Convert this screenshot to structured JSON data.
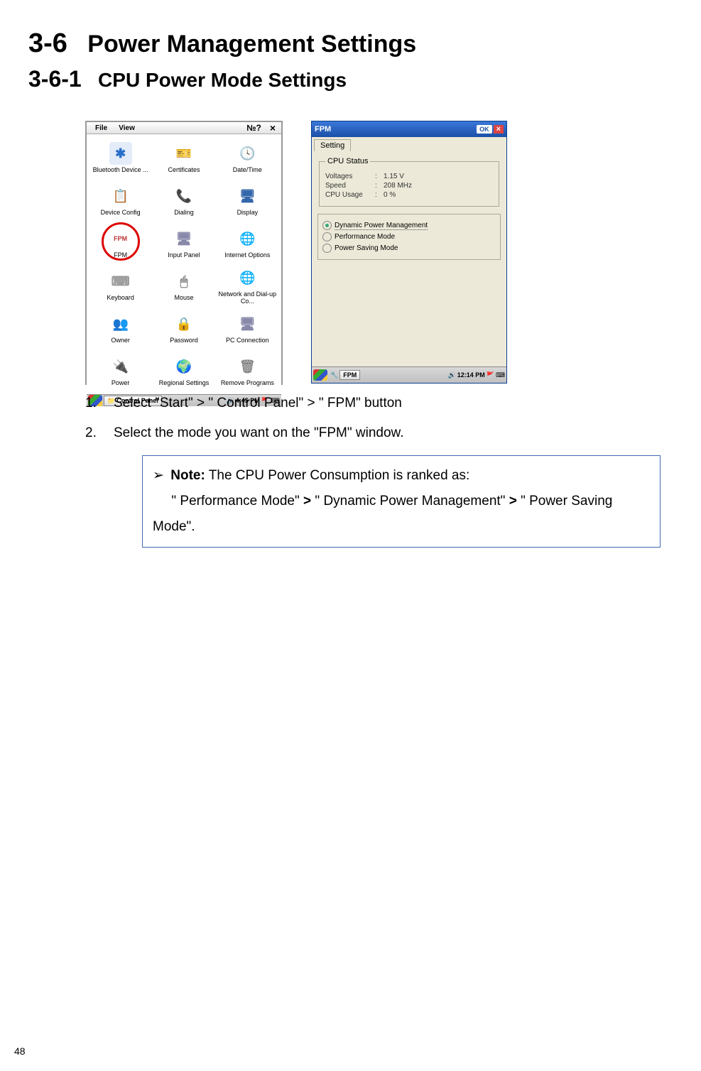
{
  "heading1": {
    "num": "3-6",
    "title": "Power Management Settings"
  },
  "heading2": {
    "num": "3-6-1",
    "title": "CPU Power Mode Settings"
  },
  "controlPanel": {
    "menu": {
      "file": "File",
      "view": "View"
    },
    "icons": [
      {
        "label": "Bluetooth Device ...",
        "glyph": "✱",
        "color": "#2a6fc9"
      },
      {
        "label": "Certificates",
        "glyph": "🎫",
        "color": "#c88"
      },
      {
        "label": "Date/Time",
        "glyph": "🕓",
        "color": "#888"
      },
      {
        "label": "Device Config",
        "glyph": "📋",
        "color": "#c63"
      },
      {
        "label": "Dialing",
        "glyph": "📞",
        "color": "#88a"
      },
      {
        "label": "Display",
        "glyph": "🖥",
        "color": "#36a"
      },
      {
        "label": "FPM",
        "glyph": "FPM",
        "color": "#b33",
        "highlight": true
      },
      {
        "label": "Input Panel",
        "glyph": "🖥",
        "color": "#88a"
      },
      {
        "label": "Internet Options",
        "glyph": "🌐",
        "color": "#3a8"
      },
      {
        "label": "Keyboard",
        "glyph": "⌨",
        "color": "#999"
      },
      {
        "label": "Mouse",
        "glyph": "🖱",
        "color": "#888"
      },
      {
        "label": "Network and Dial-up Co...",
        "glyph": "🌐",
        "color": "#36a"
      },
      {
        "label": "Owner",
        "glyph": "👥",
        "color": "#c83"
      },
      {
        "label": "Password",
        "glyph": "🔒",
        "color": "#ca3"
      },
      {
        "label": "PC Connection",
        "glyph": "🖥",
        "color": "#88a"
      },
      {
        "label": "Power",
        "glyph": "🔌",
        "color": "#888"
      },
      {
        "label": "Regional Settings",
        "glyph": "🌍",
        "color": "#3a8"
      },
      {
        "label": "Remove Programs",
        "glyph": "🗑",
        "color": "#888"
      }
    ],
    "taskbar": {
      "button": "Control Panel",
      "time": "4:45 PM"
    }
  },
  "fpm": {
    "title": "FPM",
    "ok": "OK",
    "tab": "Setting",
    "statusTitle": "CPU Status",
    "status": [
      {
        "label": "Voltages",
        "value": "1.15 V"
      },
      {
        "label": "Speed",
        "value": "208 MHz"
      },
      {
        "label": "CPU Usage",
        "value": "0 %"
      }
    ],
    "options": [
      {
        "label": "Dynamic Power Management",
        "selected": true
      },
      {
        "label": "Performance Mode",
        "selected": false
      },
      {
        "label": "Power Saving Mode",
        "selected": false
      }
    ],
    "taskbar": {
      "button": "FPM",
      "time": "12:14 PM"
    }
  },
  "steps": [
    {
      "num": "1.",
      "text": "Select \"Start\" > \" Control Panel\"    > \" FPM\" button"
    },
    {
      "num": "2.",
      "text": "Select the mode you want on the \"FPM\" window."
    }
  ],
  "note": {
    "label": "Note:",
    "line1": " The CPU Power Consumption is ranked as:",
    "line2a": "\" Performance Mode\" ",
    "gt": ">",
    "line2b": " \" Dynamic Power Management\" ",
    "line2c": " \" Power Saving Mode\"."
  },
  "pageNum": "48"
}
